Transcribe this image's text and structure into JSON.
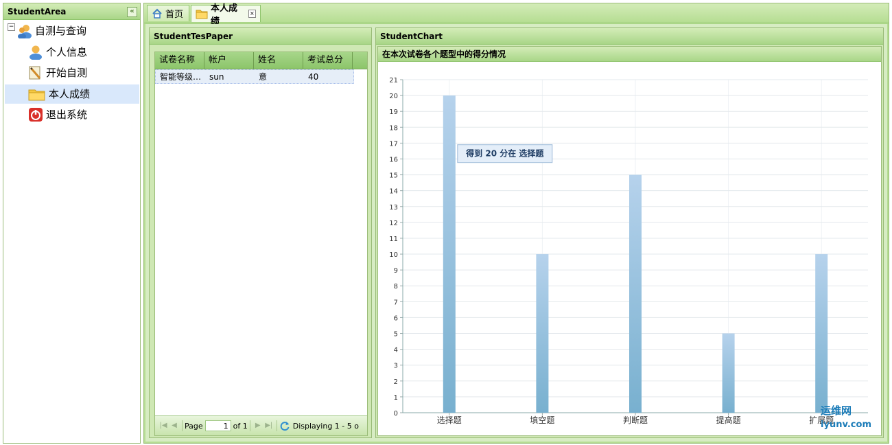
{
  "west": {
    "title": "StudentArea",
    "collapse_icon": "«",
    "tree": [
      {
        "label": "自测与查询",
        "icon": "user-group-icon"
      },
      {
        "label": "个人信息",
        "icon": "user-icon"
      },
      {
        "label": "开始自测",
        "icon": "pencil-icon"
      },
      {
        "label": "本人成绩",
        "icon": "folder-icon"
      },
      {
        "label": "退出系统",
        "icon": "power-icon"
      }
    ]
  },
  "tabs": [
    {
      "label": "首页",
      "icon": "home-icon"
    },
    {
      "label": "本人成绩",
      "icon": "folder-icon",
      "active": true
    }
  ],
  "paper_panel": {
    "title": "StudentTesPaper",
    "columns": [
      "试卷名称",
      "帐户",
      "姓名",
      "考试总分"
    ],
    "rows": [
      [
        "智能等级…",
        "sun",
        "意",
        "40"
      ]
    ],
    "pager": {
      "page_label": "Page",
      "page_value": "1",
      "of_label": "of 1",
      "display_text": "Displaying 1 - 5 o"
    }
  },
  "chart_panel": {
    "title": "StudentChart",
    "subtitle": "在本次试卷各个题型中的得分情况",
    "tooltip": "得到 20 分在 选择题"
  },
  "chart_data": {
    "type": "bar",
    "title": "在本次试卷各个题型中的得分情况",
    "categories": [
      "选择题",
      "填空题",
      "判断题",
      "提高题",
      "扩展题"
    ],
    "values": [
      20,
      10,
      15,
      5,
      10
    ],
    "ylim": [
      0,
      21
    ],
    "yticks": [
      0,
      1,
      2,
      3,
      4,
      5,
      6,
      7,
      8,
      9,
      10,
      11,
      12,
      13,
      14,
      15,
      16,
      17,
      18,
      19,
      20,
      21
    ],
    "grid": true,
    "bar_color_top": "#b6d2ec",
    "bar_color_bottom": "#78b0cf"
  },
  "watermark": {
    "name": "运维网",
    "url": "iyunv.com"
  }
}
